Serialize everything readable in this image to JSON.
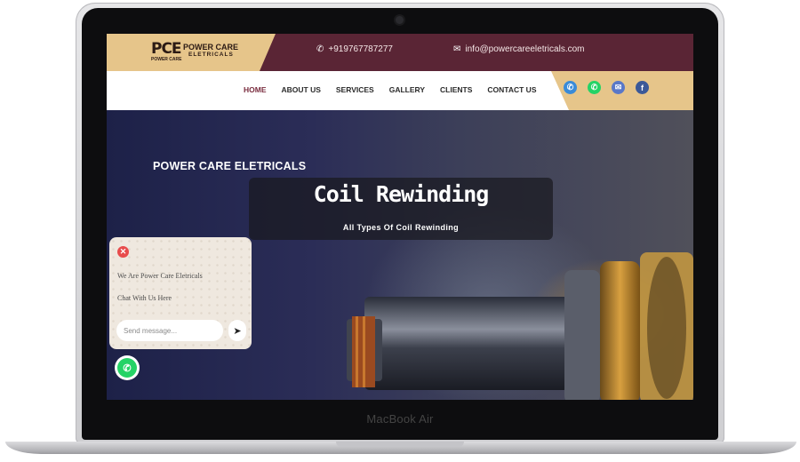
{
  "device": {
    "label": "MacBook Air"
  },
  "header": {
    "logo": {
      "mark": "PCE",
      "mark_sub": "POWER CARE",
      "name_line1": "POWER CARE",
      "name_line2": "ELETRICALS"
    },
    "phone": "+919767787277",
    "email": "info@powercareeletricals.com"
  },
  "nav": {
    "items": [
      {
        "label": "HOME",
        "active": true
      },
      {
        "label": "ABOUT US"
      },
      {
        "label": "SERVICES"
      },
      {
        "label": "GALLERY"
      },
      {
        "label": "CLIENTS"
      },
      {
        "label": "CONTACT US"
      }
    ],
    "social": [
      {
        "icon": "phone-icon",
        "color": "#3a8bd8",
        "glyph": "✆"
      },
      {
        "icon": "whatsapp-icon",
        "color": "#25d366",
        "glyph": "✆"
      },
      {
        "icon": "mail-icon",
        "color": "#5a78c8",
        "glyph": "✉"
      },
      {
        "icon": "facebook-icon",
        "color": "#3b5998",
        "glyph": "f"
      }
    ]
  },
  "hero": {
    "kicker": "POWER CARE ELETRICALS",
    "title": "Coil Rewinding",
    "subtitle": "All Types Of Coil Rewinding"
  },
  "chat": {
    "line1": "We Are Power Care Eletricals",
    "line2": "Chat With Us Here",
    "placeholder": "Send message..."
  },
  "colors": {
    "maroon": "#5a2535",
    "gold": "#e6c58a",
    "whatsapp": "#25d366"
  }
}
